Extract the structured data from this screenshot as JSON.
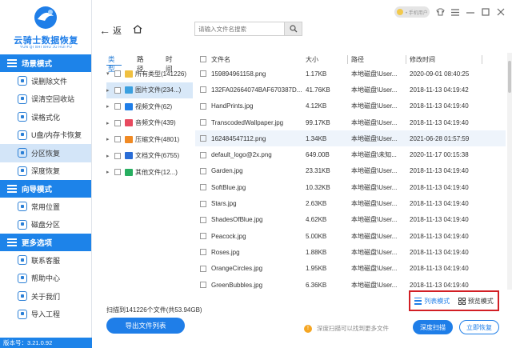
{
  "app": {
    "name": "云骑士数据恢复",
    "pinyin": "YUN QI SHI SHU JU HUI FU",
    "user": "• 手机用户",
    "version": "版本号：3.21.0.92"
  },
  "sidebar": {
    "sections": [
      {
        "title": "场景模式",
        "items": [
          "误删除文件",
          "误清空回收站",
          "误格式化",
          "U盘/内存卡恢复",
          "分区恢复",
          "深度恢复"
        ]
      },
      {
        "title": "向导模式",
        "items": [
          "常用位置",
          "磁盘分区"
        ]
      },
      {
        "title": "更多选项",
        "items": [
          "联系客服",
          "帮助中心",
          "关于我们",
          "导入工程"
        ]
      }
    ],
    "active_item": "分区恢复"
  },
  "toolbar": {
    "back_label": "返",
    "home_icon": "home-icon",
    "search_placeholder": "请输入文件名搜索"
  },
  "tree": {
    "tabs": [
      "类型",
      "路径",
      "时间"
    ],
    "active_tab": "类型",
    "items": [
      {
        "label": "所有类型(141226)",
        "color": "#f0c040",
        "selected": false
      },
      {
        "label": "图片文件(234...)",
        "color": "#3aa0e0",
        "selected": true
      },
      {
        "label": "视频文件(62)",
        "color": "#1f7ee8",
        "selected": false
      },
      {
        "label": "音频文件(439)",
        "color": "#e84a5f",
        "selected": false
      },
      {
        "label": "压缩文件(4801)",
        "color": "#f08a24",
        "selected": false
      },
      {
        "label": "文档文件(6755)",
        "color": "#2a6dd6",
        "selected": false
      },
      {
        "label": "其他文件(12...)",
        "color": "#27ae60",
        "selected": false
      }
    ]
  },
  "table": {
    "columns": [
      "文件名",
      "大小",
      "路径",
      "修改时间"
    ],
    "rows": [
      {
        "name": "159894961158.png",
        "size": "1.17KB",
        "path": "本地磁盘\\User...",
        "date": "2020-09-01 08:40:25"
      },
      {
        "name": "132FA02664074BAF670387D...",
        "size": "41.76KB",
        "path": "本地磁盘\\User...",
        "date": "2018-11-13 04:19:42"
      },
      {
        "name": "HandPrints.jpg",
        "size": "4.12KB",
        "path": "本地磁盘\\User...",
        "date": "2018-11-13 04:19:40"
      },
      {
        "name": "TranscodedWallpaper.jpg",
        "size": "99.17KB",
        "path": "本地磁盘\\User...",
        "date": "2018-11-13 04:19:40"
      },
      {
        "name": "162484547112.png",
        "size": "1.34KB",
        "path": "本地磁盘\\User...",
        "date": "2021-06-28 01:57:59"
      },
      {
        "name": "default_logo@2x.png",
        "size": "649.00B",
        "path": "本地磁盘\\未知...",
        "date": "2020-11-17 00:15:38"
      },
      {
        "name": "Garden.jpg",
        "size": "23.31KB",
        "path": "本地磁盘\\User...",
        "date": "2018-11-13 04:19:40"
      },
      {
        "name": "SoftBlue.jpg",
        "size": "10.32KB",
        "path": "本地磁盘\\User...",
        "date": "2018-11-13 04:19:40"
      },
      {
        "name": "Stars.jpg",
        "size": "2.63KB",
        "path": "本地磁盘\\User...",
        "date": "2018-11-13 04:19:40"
      },
      {
        "name": "ShadesOfBlue.jpg",
        "size": "4.62KB",
        "path": "本地磁盘\\User...",
        "date": "2018-11-13 04:19:40"
      },
      {
        "name": "Peacock.jpg",
        "size": "5.00KB",
        "path": "本地磁盘\\User...",
        "date": "2018-11-13 04:19:40"
      },
      {
        "name": "Roses.jpg",
        "size": "1.88KB",
        "path": "本地磁盘\\User...",
        "date": "2018-11-13 04:19:40"
      },
      {
        "name": "OrangeCircles.jpg",
        "size": "1.95KB",
        "path": "本地磁盘\\User...",
        "date": "2018-11-13 04:19:40"
      },
      {
        "name": "GreenBubbles.jpg",
        "size": "6.36KB",
        "path": "本地磁盘\\User...",
        "date": "2018-11-13 04:19:40"
      }
    ]
  },
  "viewmodes": {
    "list": "列表模式",
    "preview": "预览模式",
    "active": "list"
  },
  "bottom": {
    "scan_info": "扫描到141226个文件(共53.94GB)",
    "export_label": "导出文件列表",
    "tip": "深度扫描可以找到更多文件",
    "deep_scan_label": "深度扫描",
    "recover_label": "立即恢复"
  }
}
